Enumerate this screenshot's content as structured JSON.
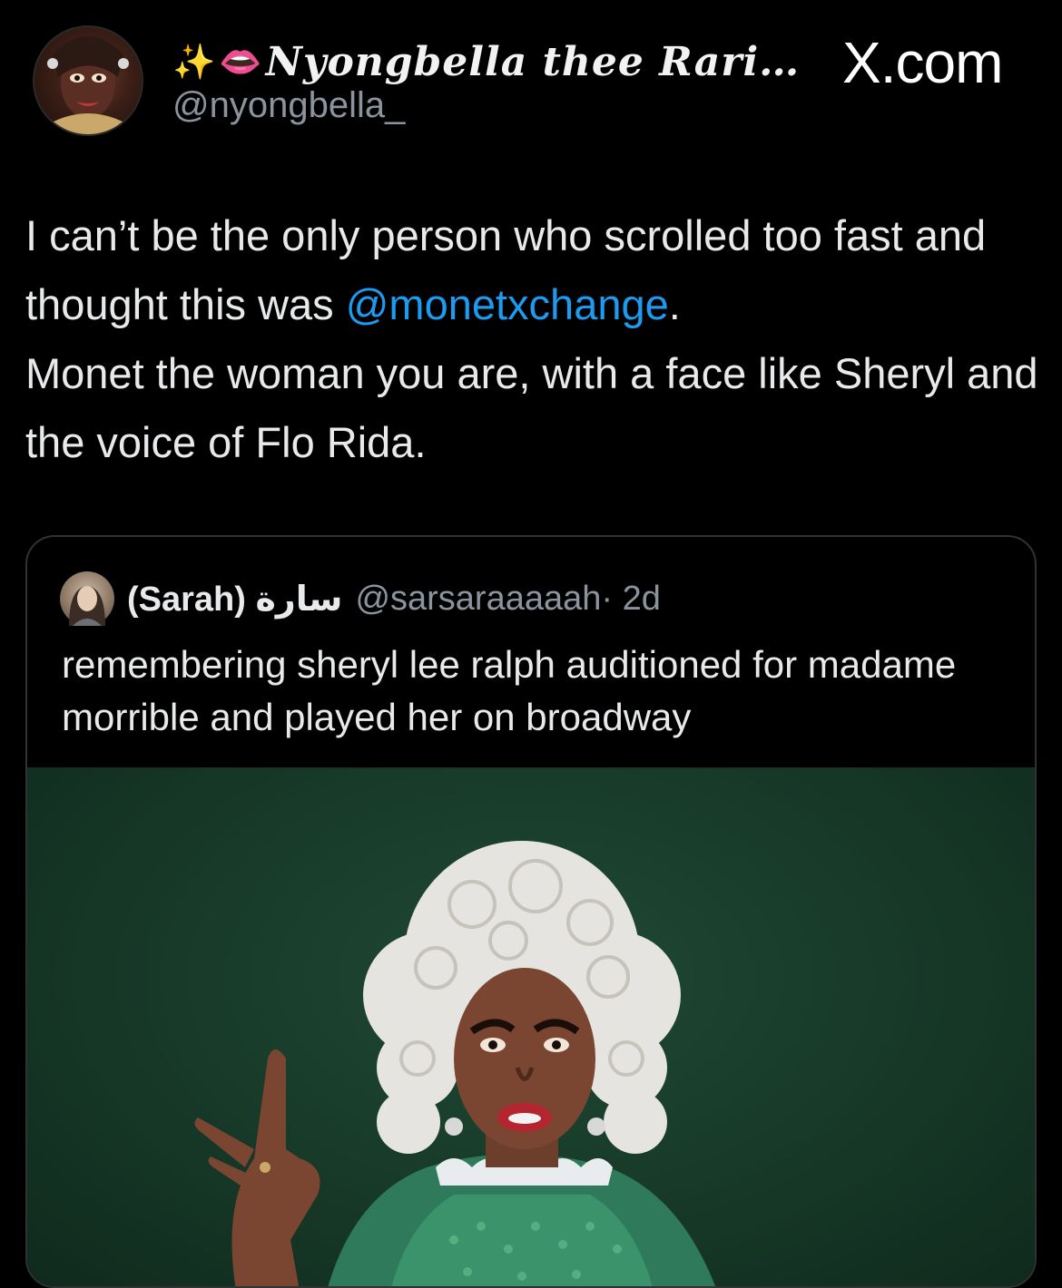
{
  "post": {
    "author": {
      "display_name": "Nyongbella thee Rari…",
      "handle": "@nyongbella_",
      "name_emojis": [
        "✨",
        "👄"
      ]
    },
    "source_label": "X.com",
    "text_parts": {
      "line1": "I can’t be the only person who scrolled too fast and thought this was ",
      "mention": "@monetxchange",
      "line1_end": ".",
      "line2": "Monet the woman you are, with a face like Sheryl and the voice of Flo Rida."
    }
  },
  "quoted_post": {
    "author_name": "(Sarah) سارة",
    "handle": "@sarsaraaaaah",
    "time": " · 2d",
    "text": "remembering sheryl lee ralph auditioned for madame morrible and played her on broadway",
    "image": "photo-of-performer-in-white-curled-wig-and-green-costume"
  },
  "colors": {
    "background": "#000000",
    "text": "#e7e9ea",
    "secondary_text": "#8b949e",
    "link": "#1d9bf0",
    "card_border": "#2f3336",
    "photo_background": "#1f4a34"
  }
}
